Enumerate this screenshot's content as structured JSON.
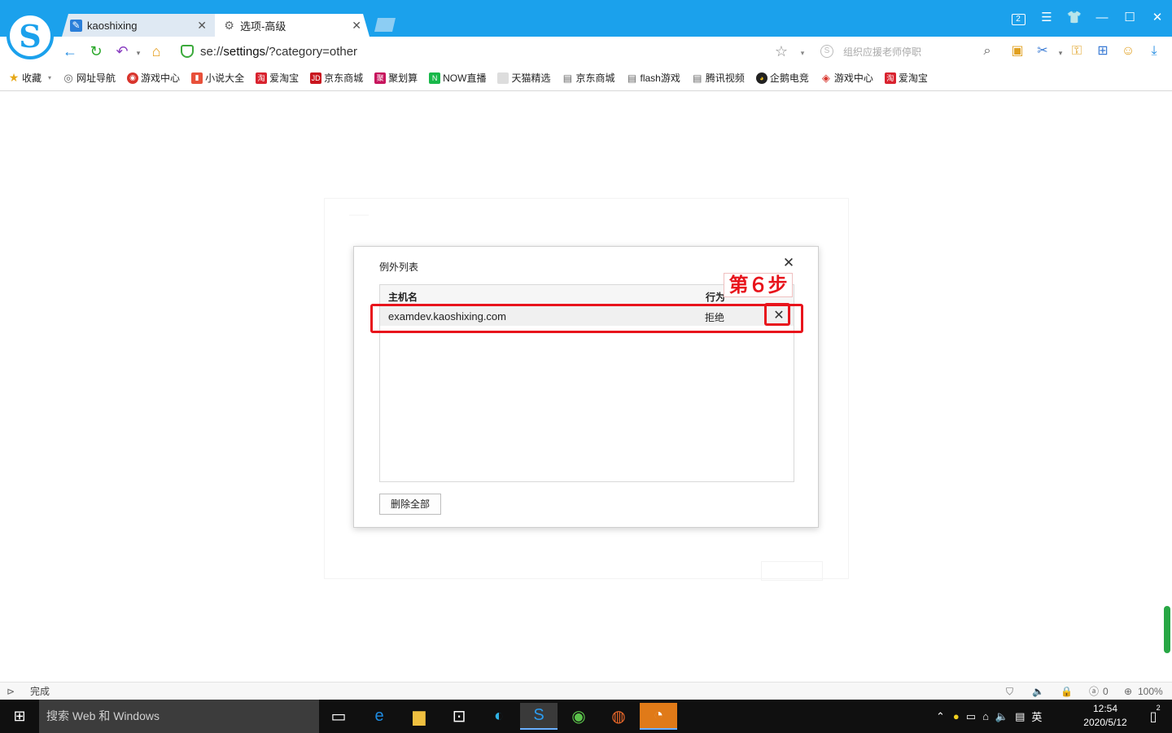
{
  "browser": {
    "tabs": [
      {
        "label": "kaoshixing"
      },
      {
        "label": "选项-高级"
      }
    ],
    "window_badge": "2",
    "address": {
      "prefix": "se://",
      "bold": "settings",
      "suffix": "/?category=other"
    },
    "search": {
      "placeholder": "组织应援老师停职"
    },
    "accent_color": "#1ba1ec"
  },
  "bookmarks": [
    {
      "label": "收藏",
      "icon": "star-icon"
    },
    {
      "label": "网址导航",
      "icon": "globe-icon"
    },
    {
      "label": "游戏中心",
      "icon": "game-icon"
    },
    {
      "label": "小说大全",
      "icon": "book-icon"
    },
    {
      "label": "爱淘宝",
      "icon": "taobao-icon"
    },
    {
      "label": "京东商城",
      "icon": "jd-icon"
    },
    {
      "label": "聚划算",
      "icon": "juhuasuan-icon"
    },
    {
      "label": "NOW直播",
      "icon": "now-icon"
    },
    {
      "label": "天猫精选",
      "icon": "tmall-icon"
    },
    {
      "label": "京东商城",
      "icon": "page-icon"
    },
    {
      "label": "flash游戏",
      "icon": "page-icon"
    },
    {
      "label": "腾讯视频",
      "icon": "page-icon"
    },
    {
      "label": "企鹅电竞",
      "icon": "penguin-icon"
    },
    {
      "label": "游戏中心",
      "icon": "gamepad-icon"
    },
    {
      "label": "爱淘宝",
      "icon": "taobao-icon"
    }
  ],
  "dialog": {
    "title": "例外列表",
    "columns": {
      "host": "主机名",
      "action": "行为"
    },
    "rows": [
      {
        "host": "examdev.kaoshixing.com",
        "action": "拒绝"
      }
    ],
    "delete_all": "删除全部"
  },
  "annotation": {
    "step_label": "第６步",
    "color": "#e8141c"
  },
  "statusbar": {
    "status": "完成",
    "counter": "0",
    "zoom": "100%"
  },
  "taskbar": {
    "search_placeholder": "搜索 Web 和 Windows",
    "ime": "英",
    "time": "12:54",
    "date": "2020/5/12",
    "notification_count": "2"
  }
}
